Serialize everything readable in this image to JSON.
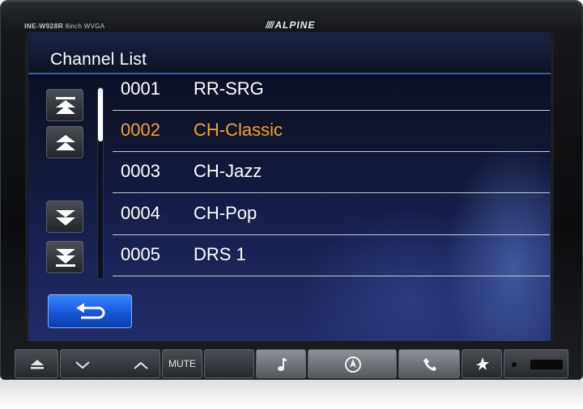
{
  "device": {
    "model": "INE-W928R",
    "model_sub": "8inch WVGA",
    "brand": "ALPINE"
  },
  "screen": {
    "title": "Channel List",
    "channels": [
      {
        "number": "0001",
        "name": "RR-SRG",
        "selected": false
      },
      {
        "number": "0002",
        "name": "CH-Classic",
        "selected": true
      },
      {
        "number": "0003",
        "name": "CH-Jazz",
        "selected": false
      },
      {
        "number": "0004",
        "name": "CH-Pop",
        "selected": false
      },
      {
        "number": "0005",
        "name": "DRS 1",
        "selected": false
      }
    ],
    "scroll_buttons": [
      "page-up-icon",
      "up-icon",
      "down-icon",
      "page-down-icon"
    ],
    "back_icon": "back-arrow-icon"
  },
  "hardware_buttons": {
    "eject_icon": "eject-icon",
    "vol_down_icon": "chevron-down-icon",
    "vol_up_icon": "chevron-up-icon",
    "mute_label": "MUTE",
    "audio_icon": "music-note-icon",
    "nav_icon": "navigation-icon",
    "phone_icon": "phone-icon",
    "favorite_icon": "star-icon"
  },
  "colors": {
    "accent_selected": "#f3a227",
    "back_button": "#1f63e6",
    "text": "#ffffff"
  }
}
